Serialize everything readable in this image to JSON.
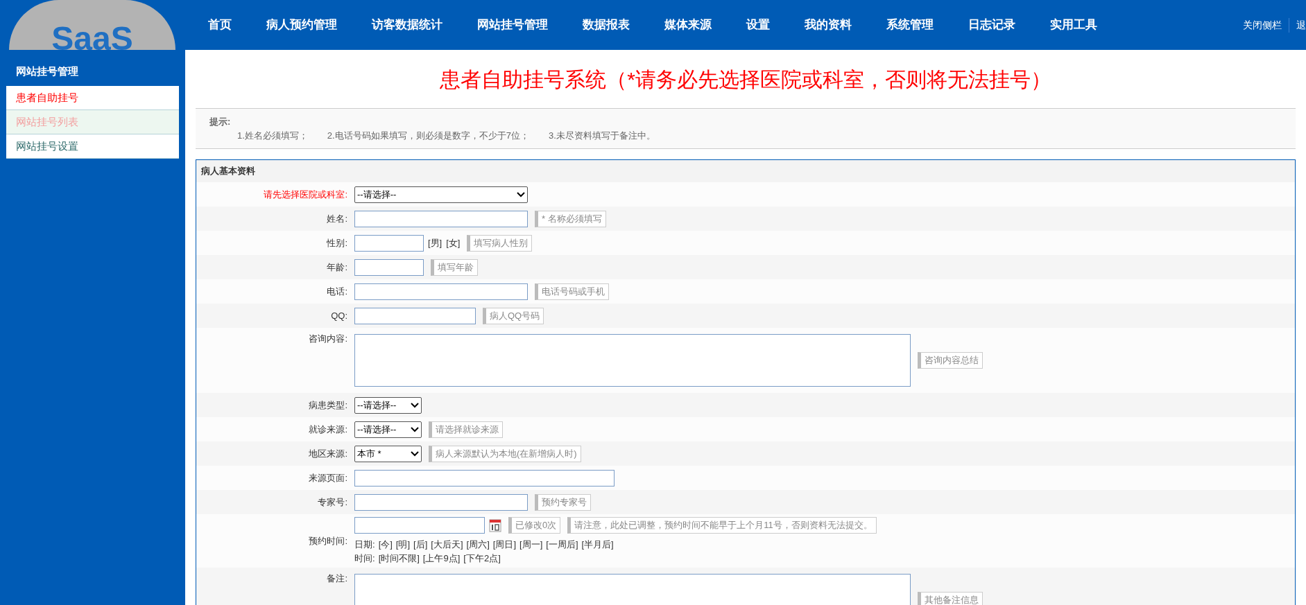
{
  "logo": {
    "text": "SaaS"
  },
  "nav": {
    "items": [
      "首页",
      "病人预约管理",
      "访客数据统计",
      "网站挂号管理",
      "数据报表",
      "媒体来源",
      "设置",
      "我的资料",
      "系统管理",
      "日志记录",
      "实用工具"
    ],
    "right_links": [
      "关闭侧栏",
      "退"
    ]
  },
  "sidebar": {
    "title": "网站挂号管理",
    "items": [
      {
        "label": "患者自助挂号",
        "selected": true,
        "highlighted": false
      },
      {
        "label": "网站挂号列表",
        "selected": false,
        "highlighted": true
      },
      {
        "label": "网站挂号设置",
        "selected": false,
        "highlighted": false
      }
    ]
  },
  "page_title": "患者自助挂号系统（*请务必先选择医院或科室，否则将无法挂号）",
  "tips": {
    "title": "提示:",
    "items": [
      "1.姓名必须填写；",
      "2.电话号码如果填写，则必须是数字，不少于7位；",
      "3.未尽资料填写于备注中。"
    ]
  },
  "form": {
    "section_title": "病人基本资料",
    "fields": [
      {
        "label": "请先选择医院或科室:",
        "required": true,
        "kind": "select",
        "value": "--请选择--"
      },
      {
        "label": "姓名:",
        "required": false,
        "kind": "text",
        "hints": [
          "* 名称必须填写"
        ]
      },
      {
        "label": "性别:",
        "required": false,
        "kind": "gender",
        "options": [
          "[男]",
          "[女]"
        ],
        "hints": [
          "填写病人性别"
        ]
      },
      {
        "label": "年龄:",
        "required": false,
        "kind": "text",
        "hints": [
          "填写年龄"
        ]
      },
      {
        "label": "电话:",
        "required": false,
        "kind": "text",
        "hints": [
          "电话号码或手机"
        ]
      },
      {
        "label": "QQ:",
        "required": false,
        "kind": "text",
        "hints": [
          "病人QQ号码"
        ]
      },
      {
        "label": "咨询内容:",
        "required": false,
        "kind": "textarea",
        "hints": [
          "咨询内容总结"
        ]
      },
      {
        "label": "病患类型:",
        "required": false,
        "kind": "select",
        "value": "--请选择--"
      },
      {
        "label": "就诊来源:",
        "required": false,
        "kind": "select",
        "value": "--请选择--",
        "hints": [
          "请选择就诊来源"
        ]
      },
      {
        "label": "地区来源:",
        "required": false,
        "kind": "select",
        "value": "本市 *",
        "hints": [
          "病人来源默认为本地(在新增病人时)"
        ]
      },
      {
        "label": "来源页面:",
        "required": false,
        "kind": "text"
      },
      {
        "label": "专家号:",
        "required": false,
        "kind": "text",
        "hints": [
          "预约专家号"
        ]
      },
      {
        "label": "预约时间:",
        "required": false,
        "kind": "datetime",
        "hints": [
          "已修改0次",
          "请注意，此处已调整，预约时间不能早于上个月11号，否则资料无法提交。"
        ],
        "quick_dates": {
          "label": "日期:",
          "items": [
            "[今]",
            "[明]",
            "[后]",
            "[大后天]",
            "[周六]",
            "[周日]",
            "[周一]",
            "[一周后]",
            "[半月后]"
          ]
        },
        "quick_times": {
          "label": "时间:",
          "items": [
            "[时间不限]",
            "[上午9点]",
            "[下午2点]"
          ]
        }
      },
      {
        "label": "备注:",
        "required": false,
        "kind": "textarea",
        "hints": [
          "其他备注信息"
        ]
      }
    ]
  }
}
